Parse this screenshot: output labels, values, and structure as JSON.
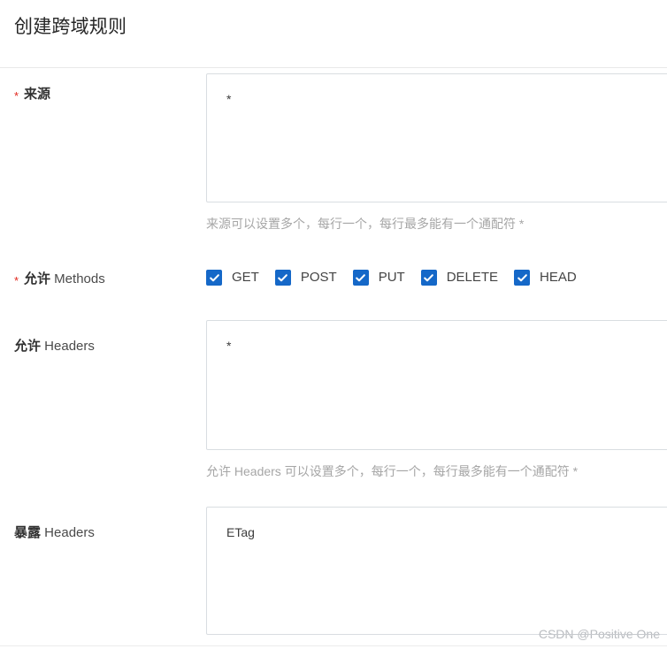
{
  "dialog": {
    "title": "创建跨域规则"
  },
  "fields": {
    "origin": {
      "required_mark": "*",
      "label_cn": "来源",
      "label_en": "",
      "value": "*",
      "placeholder": "",
      "help": "来源可以设置多个，每行一个，每行最多能有一个通配符 *"
    },
    "methods": {
      "required_mark": "*",
      "label_cn": "允许",
      "label_en": " Methods",
      "options": [
        {
          "label": "GET",
          "checked": true
        },
        {
          "label": "POST",
          "checked": true
        },
        {
          "label": "PUT",
          "checked": true
        },
        {
          "label": "DELETE",
          "checked": true
        },
        {
          "label": "HEAD",
          "checked": true
        }
      ]
    },
    "allow_headers": {
      "required_mark": "",
      "label_cn": "允许",
      "label_en": " Headers",
      "value": "*",
      "placeholder": "",
      "help": "允许 Headers 可以设置多个，每行一个，每行最多能有一个通配符 *"
    },
    "expose_headers": {
      "required_mark": "",
      "label_cn": "暴露",
      "label_en": " Headers",
      "value": "ETag",
      "placeholder": "",
      "help": ""
    }
  },
  "watermark": {
    "text": "CSDN @Positive One"
  },
  "colors": {
    "checkbox_blue": "#1568c8",
    "required_red": "#e1251b",
    "help_gray": "#a6a6a6",
    "border_gray": "#d9dde1",
    "title_color": "#262626"
  }
}
